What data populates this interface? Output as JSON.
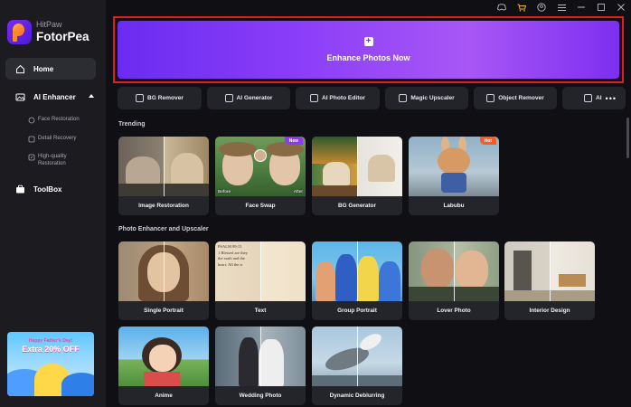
{
  "app": {
    "brand": "HitPaw",
    "name": "FotorPea"
  },
  "sidebar": {
    "home": "Home",
    "ai_enhancer": "AI Enhancer",
    "sub_items": [
      "Face Restoration",
      "Detail Recovery",
      "High-quality Restoration"
    ],
    "toolbox": "ToolBox",
    "promo": {
      "line1": "Happy Father's Day!",
      "line2": "Extra 20% OFF"
    }
  },
  "hero": {
    "label": "Enhance Photos Now"
  },
  "tools": [
    "BG Remover",
    "AI Generator",
    "AI Photo Editor",
    "Magic Upscaler",
    "Object Remover",
    "AI"
  ],
  "sections": {
    "trending": "Trending",
    "photo": "Photo Enhancer and Upscaler"
  },
  "trending_cards": [
    {
      "label": "Image Restoration"
    },
    {
      "label": "Face Swap",
      "badge": "New",
      "before": "Before",
      "after": "After"
    },
    {
      "label": "BG Generator"
    },
    {
      "label": "Labubu",
      "badge": "Hot"
    }
  ],
  "photo_cards": [
    {
      "label": "Single Portrait"
    },
    {
      "label": "Text"
    },
    {
      "label": "Group Portrait"
    },
    {
      "label": "Lover Photo"
    },
    {
      "label": "Interior Design"
    },
    {
      "label": "Anime"
    },
    {
      "label": "Wedding Photo"
    },
    {
      "label": "Dynamic Deblurring"
    }
  ],
  "text_card_lines": [
    "PSALM 89:15",
    "1 Blessed are they",
    "the earth and the",
    "heart. All the tr"
  ],
  "colors": {
    "accent": "#8a3df8",
    "highlight": "#e02020",
    "new_badge": "#8d39f5",
    "hot_badge": "#ff5a24"
  }
}
